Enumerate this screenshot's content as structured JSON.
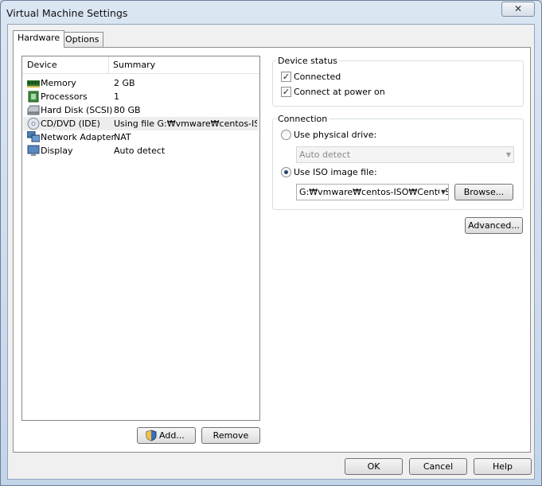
{
  "window": {
    "title": "Virtual Machine Settings",
    "close_glyph": "✕"
  },
  "tabs": [
    {
      "label": "Hardware"
    },
    {
      "label": "Options"
    }
  ],
  "device_list": {
    "columns": {
      "device": "Device",
      "summary": "Summary"
    },
    "rows": [
      {
        "name": "Memory",
        "summary": "2 GB",
        "icon": "memory-icon"
      },
      {
        "name": "Processors",
        "summary": "1",
        "icon": "processor-icon"
      },
      {
        "name": "Hard Disk (SCSI)",
        "summary": "80 GB",
        "icon": "hard-disk-icon"
      },
      {
        "name": "CD/DVD (IDE)",
        "summary": "Using file G:₩vmware₩centos-IS...",
        "icon": "cd-dvd-icon",
        "selected": true
      },
      {
        "name": "Network Adapter",
        "summary": "NAT",
        "icon": "network-adapter-icon"
      },
      {
        "name": "Display",
        "summary": "Auto detect",
        "icon": "display-icon"
      }
    ],
    "add_label": "Add...",
    "remove_label": "Remove"
  },
  "device_status": {
    "title": "Device status",
    "connected_label": "Connected",
    "connected_checked": true,
    "connect_power_label": "Connect at power on",
    "connect_power_checked": true
  },
  "connection": {
    "title": "Connection",
    "physical_label": "Use physical drive:",
    "physical_value": "Auto detect",
    "iso_label": "Use ISO image file:",
    "iso_value": "G:₩vmware₩centos-ISO₩CentOS",
    "browse_label": "Browse...",
    "selected": "iso"
  },
  "advanced_label": "Advanced...",
  "footer": {
    "ok_label": "OK",
    "cancel_label": "Cancel",
    "help_label": "Help"
  },
  "colors": {
    "window_bg": "#c4d4e8",
    "radio_dot": "#25476f"
  }
}
